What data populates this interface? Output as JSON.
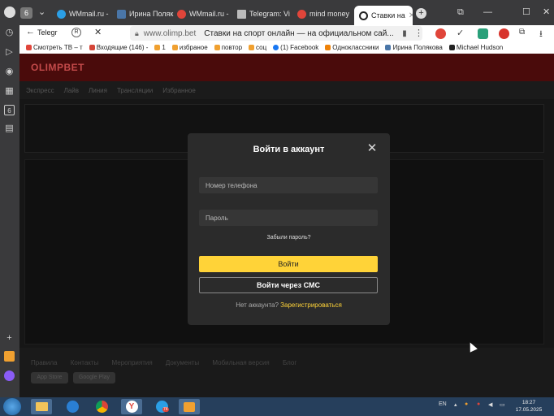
{
  "browser": {
    "tab_count": "6",
    "tabs": [
      {
        "label": "WMmail.ru - ",
        "color": "#2b9fe6"
      },
      {
        "label": "Ирина Поляк",
        "color": "#4a76a8"
      },
      {
        "label": "WMmail.ru - ",
        "color": "#e0453a"
      },
      {
        "label": "Telegram: Vi",
        "color": "#888888"
      },
      {
        "label": "mind money",
        "color": "#e0453a"
      },
      {
        "label": "Ставки на",
        "color": "#222222"
      }
    ],
    "back_tab_label": "Telegr",
    "address_host": "www.olimp.bet",
    "address_title": "Ставки на спорт онлайн — на официальном сай...",
    "bookmarks": [
      {
        "label": "Смотреть ТВ – т",
        "color": "#e0453a"
      },
      {
        "label": "Входящие (146) -",
        "color": "#d44638"
      },
      {
        "label": "1",
        "color": "#f0a030"
      },
      {
        "label": "избраное",
        "color": "#f0a030"
      },
      {
        "label": "повтор",
        "color": "#f0a030"
      },
      {
        "label": "соц",
        "color": "#f0a030"
      },
      {
        "label": "(1) Facebook",
        "color": "#1877f2"
      },
      {
        "label": "Одноклассники",
        "color": "#ee8208"
      },
      {
        "label": "Ирина Полякова",
        "color": "#4a76a8"
      },
      {
        "label": "Michael Hudson",
        "color": "#222222"
      }
    ]
  },
  "site": {
    "logo": "OLIMPBET",
    "nav": [
      "Экспресс",
      "Лайв",
      "Линия",
      "Трансляции",
      "Избранное"
    ],
    "footer_links": [
      "Правила",
      "Контакты",
      "Мероприятия",
      "Документы",
      "Мобильная версия",
      "Блог"
    ],
    "store_buttons": [
      "App Store",
      "Google Play"
    ]
  },
  "modal": {
    "title": "Войти в аккаунт",
    "phone_placeholder": "Номер телефона",
    "password_placeholder": "Пароль",
    "forgot": "Забыли пароль?",
    "login_button": "Войти",
    "sms_button": "Войти через СМС",
    "no_account": "Нет аккаунта?",
    "register": "Зарегистрироваться"
  },
  "taskbar": {
    "language": "EN",
    "time": "18:27",
    "date": "17.05.2025",
    "telegram_badge": "74"
  }
}
